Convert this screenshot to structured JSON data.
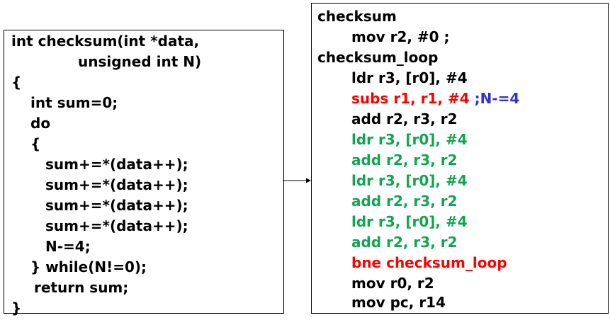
{
  "c_code": {
    "lines": [
      "int checksum(int *data,",
      "unsigned int N)",
      "{",
      "int sum=0;",
      "do",
      "{",
      "sum+=*(data++);",
      "sum+=*(data++);",
      "sum+=*(data++);",
      "sum+=*(data++);",
      "N-=4;",
      "} while(N!=0);",
      "return sum;",
      "}"
    ]
  },
  "assembly": {
    "label_checksum": "checksum",
    "mov_r2": "mov r2, #0 ;",
    "label_loop": "checksum_loop",
    "ldr_1": "ldr r3, [r0], #4",
    "subs": "subs r1, r1, #4",
    "subs_comment": ";N-=4",
    "add_1": "add r2, r3, r2",
    "ldr_2": "ldr r3, [r0], #4",
    "add_2": "add r2, r3, r2",
    "ldr_3": "ldr r3, [r0], #4",
    "add_3": "add r2, r3, r2",
    "ldr_4": "ldr r3, [r0], #4",
    "add_4": "add r2, r3, r2",
    "bne": "bne checksum_loop",
    "mov_r0": "mov r0, r2",
    "mov_pc": "mov pc, r14"
  },
  "colors": {
    "highlight_red": "#ff0000",
    "unrolled_green": "#11a550",
    "comment_blue": "#3333cc"
  }
}
